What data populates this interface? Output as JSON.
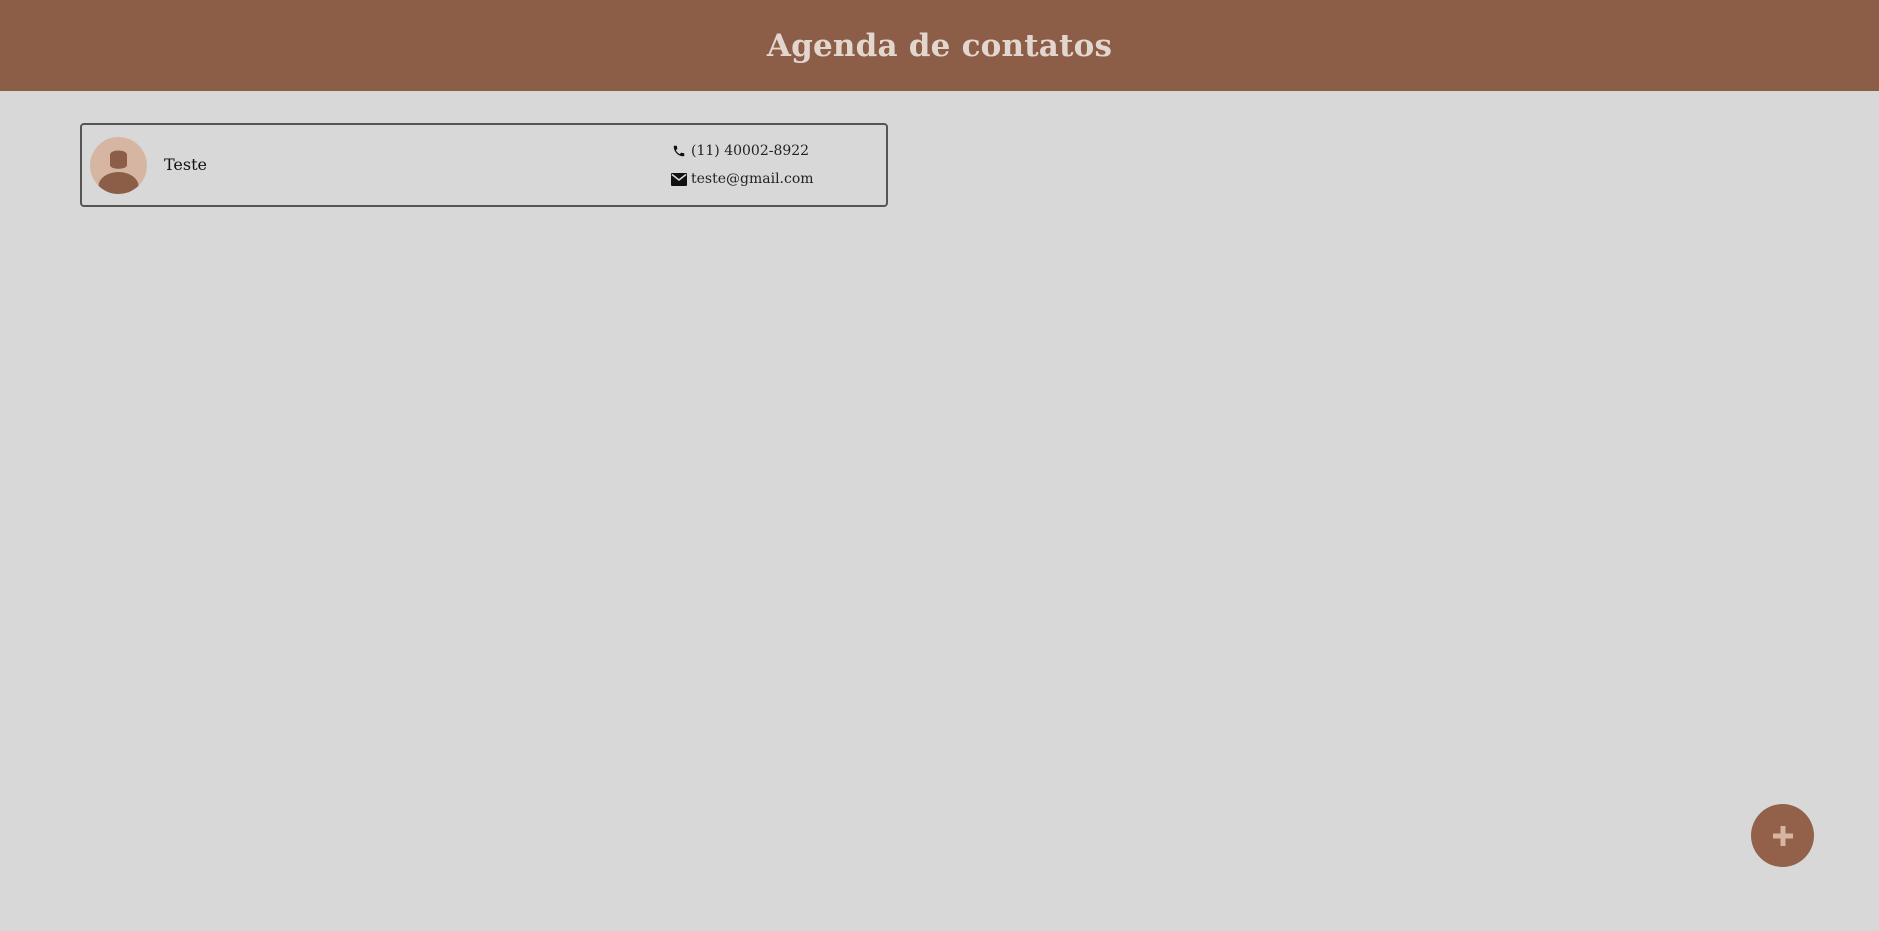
{
  "header": {
    "title": "Agenda de contatos"
  },
  "contacts": [
    {
      "name": "Teste",
      "phone": "(11) 40002-8922",
      "email": "teste@gmail.com",
      "avatar_icon": "user-silhouette-icon"
    }
  ],
  "fab": {
    "icon": "plus-icon"
  },
  "colors": {
    "header_bg": "#8c5e48",
    "header_text": "#e2d6cf",
    "page_bg": "#d8d8d8",
    "avatar_bg": "#d6b6a2",
    "avatar_figure": "#8c5e48",
    "fab_bg": "#93614a",
    "fab_icon": "#d6b6a2"
  }
}
